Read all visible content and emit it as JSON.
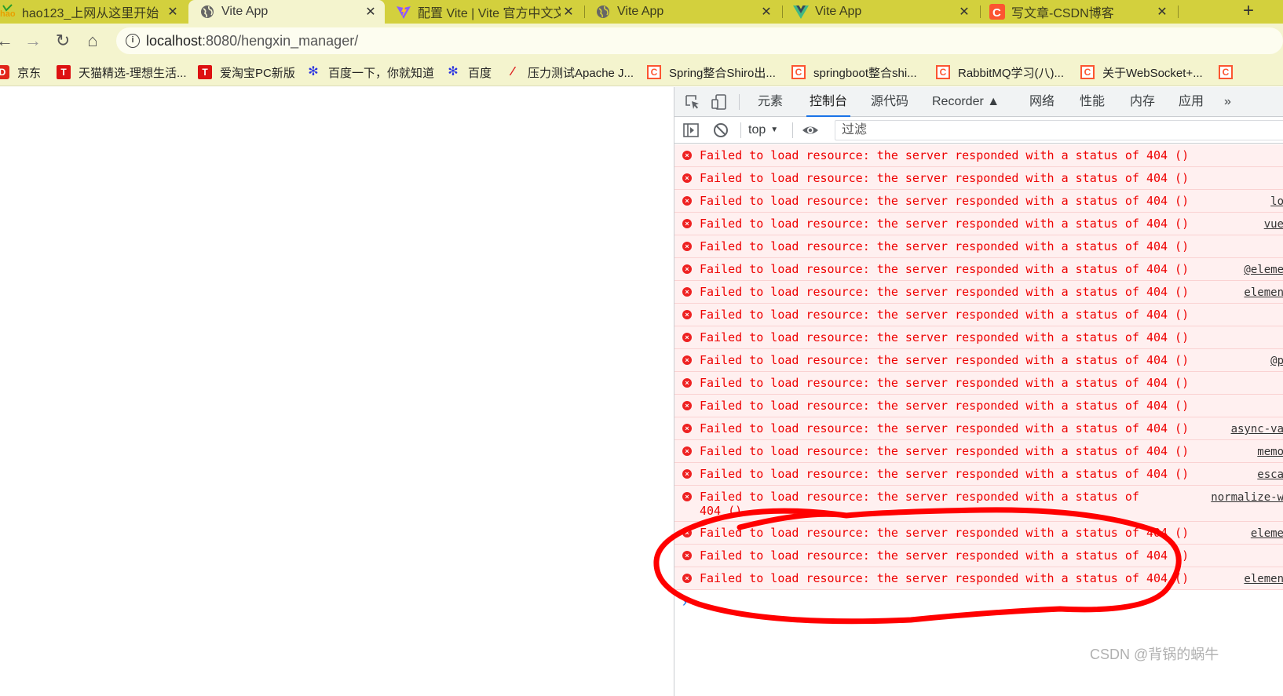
{
  "tabs": [
    {
      "title": "hao123_上网从这里开始",
      "icon": "hao123-icon",
      "close": "✕"
    },
    {
      "title": "Vite App",
      "icon": "globe-icon",
      "close": "✕"
    },
    {
      "title": "配置 Vite | Vite 官方中文文",
      "icon": "vite-logo-icon",
      "close": "✕"
    },
    {
      "title": "Vite App",
      "icon": "globe-icon",
      "close": "✕"
    },
    {
      "title": "Vite App",
      "icon": "vue-logo-icon",
      "close": "✕"
    },
    {
      "title": "写文章-CSDN博客",
      "icon": "csdn-icon",
      "close": "✕"
    }
  ],
  "new_tab_label": "+",
  "nav": {
    "back": "←",
    "forward": "→",
    "reload": "↻",
    "home": "⌂"
  },
  "address": {
    "info": "i",
    "host": "localhost",
    "path": ":8080/hengxin_manager/"
  },
  "bookmarks": [
    {
      "label": "京东",
      "glyph": "D"
    },
    {
      "label": "天猫精选-理想生活...",
      "glyph": "T"
    },
    {
      "label": "爱淘宝PC新版",
      "glyph": "T"
    },
    {
      "label": "百度一下，你就知道",
      "glyph": "✻"
    },
    {
      "label": "百度",
      "glyph": "✻"
    },
    {
      "label": "压力测试Apache J...",
      "glyph": "⁄"
    },
    {
      "label": "Spring整合Shiro出...",
      "glyph": "C"
    },
    {
      "label": "springboot整合shi...",
      "glyph": "C"
    },
    {
      "label": "RabbitMQ学习(八)...",
      "glyph": "C"
    },
    {
      "label": "关于WebSocket+...",
      "glyph": "C"
    },
    {
      "label": "",
      "glyph": "C"
    }
  ],
  "devtools": {
    "tabs": [
      "元素",
      "控制台",
      "源代码",
      "Recorder ▲",
      "网络",
      "性能",
      "内存",
      "应用",
      "»"
    ],
    "active_tab": "控制台",
    "context": "top",
    "context_arrow": "▼",
    "filter_placeholder": "过滤"
  },
  "console": {
    "messages": [
      {
        "text": "Failed to load resource: the server responded with a status of 404 ()",
        "source": ""
      },
      {
        "text": "Failed to load resource: the server responded with a status of 404 ()",
        "source": ""
      },
      {
        "text": "Failed to load resource: the server responded with a status of 404 ()",
        "source": "lo"
      },
      {
        "text": "Failed to load resource: the server responded with a status of 404 ()",
        "source": "vue"
      },
      {
        "text": "Failed to load resource: the server responded with a status of 404 ()",
        "source": ""
      },
      {
        "text": "Failed to load resource: the server responded with a status of 404 ()",
        "source": "@eleme"
      },
      {
        "text": "Failed to load resource: the server responded with a status of 404 ()",
        "source": "elemen"
      },
      {
        "text": "Failed to load resource: the server responded with a status of 404 ()",
        "source": ""
      },
      {
        "text": "Failed to load resource: the server responded with a status of 404 ()",
        "source": ""
      },
      {
        "text": "Failed to load resource: the server responded with a status of 404 ()",
        "source": "@p"
      },
      {
        "text": "Failed to load resource: the server responded with a status of 404 ()",
        "source": ""
      },
      {
        "text": "Failed to load resource: the server responded with a status of 404 ()",
        "source": ""
      },
      {
        "text": "Failed to load resource: the server responded with a status of 404 ()",
        "source": "async-va"
      },
      {
        "text": "Failed to load resource: the server responded with a status of 404 ()",
        "source": "memo"
      },
      {
        "text": "Failed to load resource: the server responded with a status of 404 ()",
        "source": "esca"
      },
      {
        "text": "Failed to load resource: the server responded with a status of 404 ()",
        "source": "normalize-w",
        "wrapped": true
      },
      {
        "text": "Failed to load resource: the server responded with a status of 404 ()",
        "source": "eleme"
      },
      {
        "text": "Failed to load resource: the server responded with a status of 404 ()",
        "source": ""
      },
      {
        "text": "Failed to load resource: the server responded with a status of 404 ()",
        "source": "elemen"
      }
    ],
    "prompt": "›"
  },
  "watermark": "CSDN @背锅的蜗牛",
  "colors": {
    "tabstrip": "#d3d03d",
    "toolbar": "#f4f4ce",
    "error_text": "#ee0000",
    "error_bg": "#fff0f0",
    "annotation": "#ff0000"
  }
}
